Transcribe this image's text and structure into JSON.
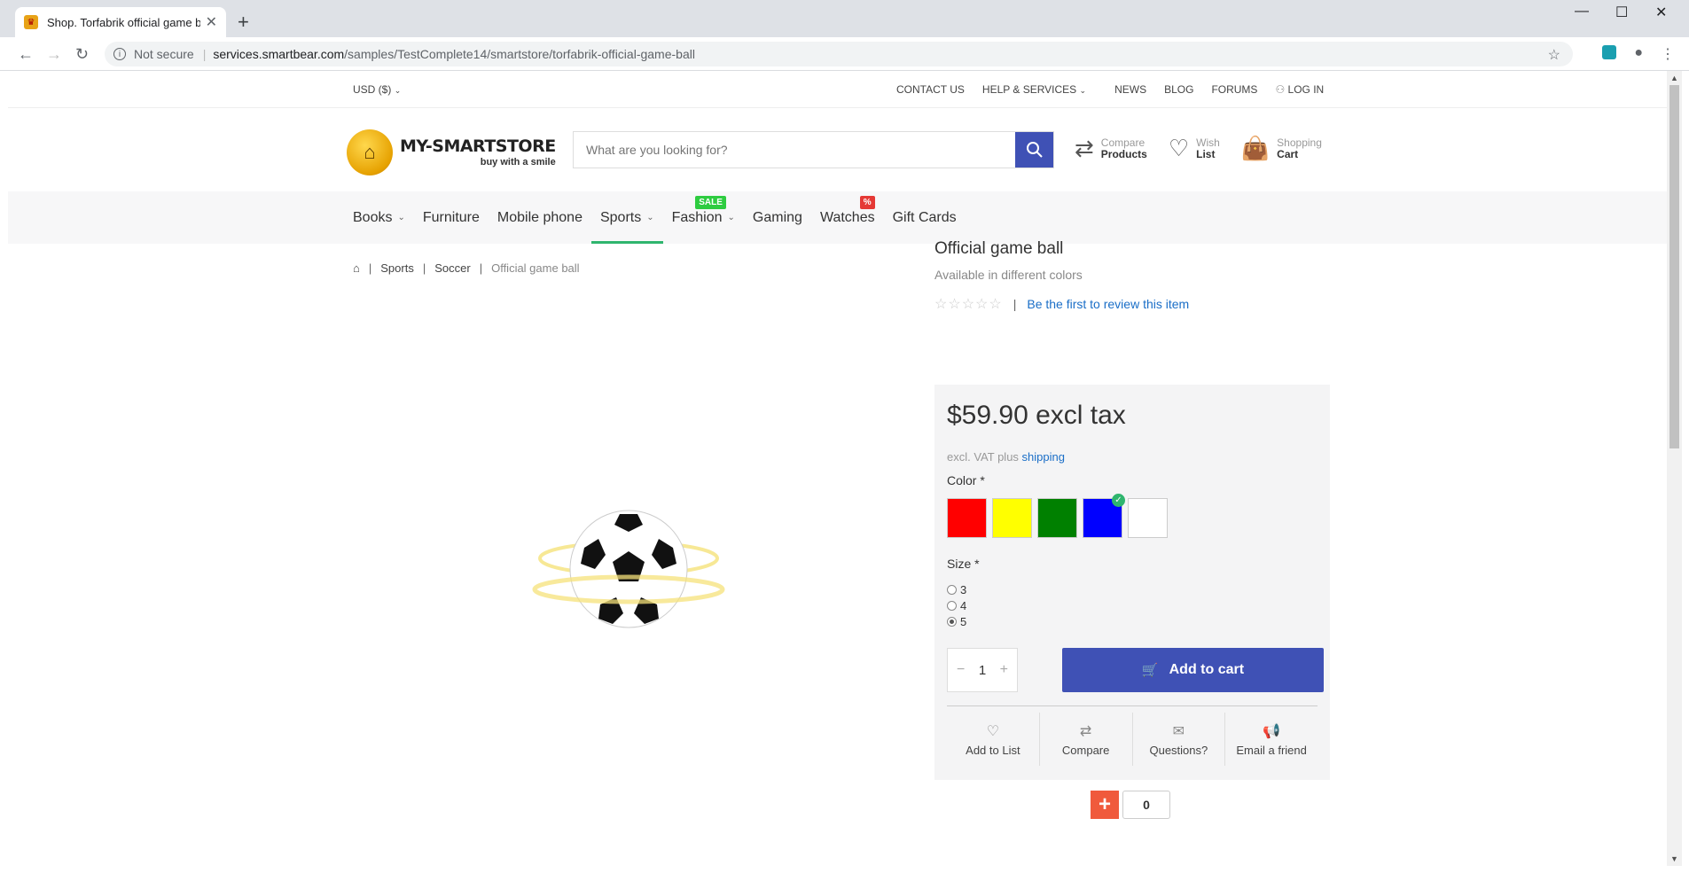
{
  "browser": {
    "tab_title": "Shop. Torfabrik official game ball",
    "security": "Not secure",
    "url_host": "services.smartbear.com",
    "url_path": "/samples/TestComplete14/smartstore/torfabrik-official-game-ball"
  },
  "topbar": {
    "currency": "USD  ($)",
    "links": [
      "CONTACT US",
      "HELP & SERVICES",
      "NEWS",
      "BLOG",
      "FORUMS",
      "LOG IN"
    ]
  },
  "header": {
    "brand": "MY-SMARTSTORE",
    "slogan": "buy with a smile",
    "search_placeholder": "What are you looking for?",
    "compare_l1": "Compare",
    "compare_l2": "Products",
    "wish_l1": "Wish",
    "wish_l2": "List",
    "cart_l1": "Shopping",
    "cart_l2": "Cart"
  },
  "nav": {
    "items": [
      "Books",
      "Furniture",
      "Mobile phone",
      "Sports",
      "Fashion",
      "Gaming",
      "Watches",
      "Gift Cards"
    ],
    "sale_badge": "SALE",
    "pct_badge": "%"
  },
  "breadcrumb": {
    "items": [
      "Sports",
      "Soccer",
      "Official game ball"
    ]
  },
  "product": {
    "title": "Official game ball",
    "subtitle": "Available in different colors",
    "review_link": "Be the first to review this item",
    "price": "$59.90 excl tax",
    "vat_prefix": "excl. VAT plus",
    "vat_link": "shipping",
    "color_label": "Color *",
    "colors": [
      "#ff0000",
      "#ffff00",
      "#008000",
      "#0000ff",
      "#ffffff"
    ],
    "selected_color": "#0000ff",
    "size_label": "Size *",
    "sizes": [
      "3",
      "4",
      "5"
    ],
    "selected_size": "5",
    "quantity": "1",
    "add_to_cart": "Add to cart",
    "actions": [
      "Add to List",
      "Compare",
      "Questions?",
      "Email a friend"
    ],
    "share_count": "0"
  }
}
